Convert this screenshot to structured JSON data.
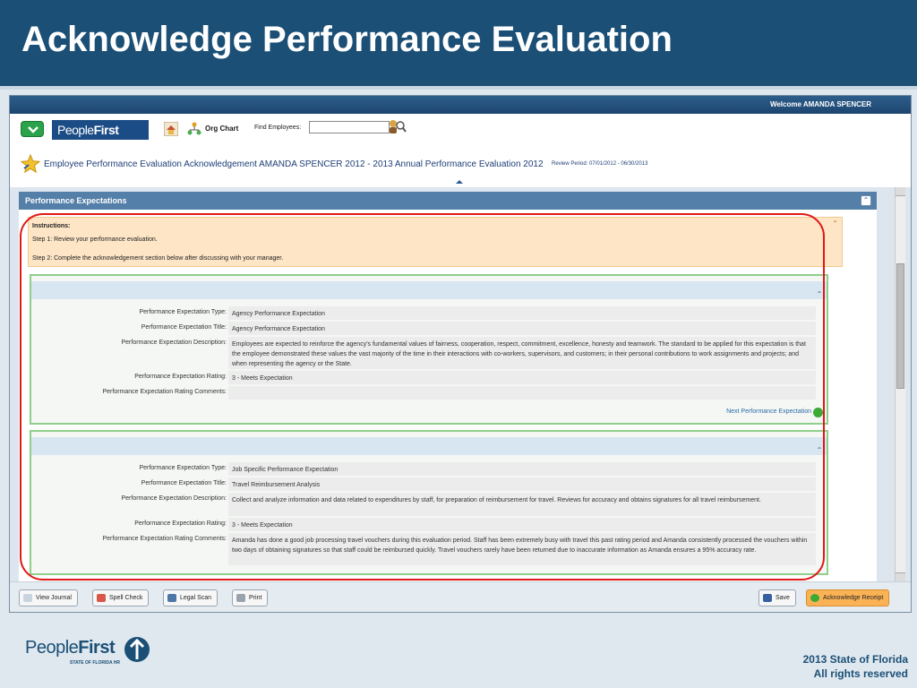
{
  "slide": {
    "title": "Acknowledge Performance Evaluation",
    "footer_copyright_line1": "2013 State of Florida",
    "footer_copyright_line2": "All rights reserved",
    "footer_logo_people": "People",
    "footer_logo_first": "First",
    "footer_logo_sub": "STATE OF FLORIDA HR"
  },
  "app": {
    "welcome": "Welcome AMANDA SPENCER",
    "logo_people": "People",
    "logo_first": "First",
    "org_chart": "Org Chart",
    "find_employees_label": "Find Employees:",
    "find_employees_value": ""
  },
  "page": {
    "title": "Employee Performance Evaluation Acknowledgement    AMANDA SPENCER   2012 - 2013 Annual Performance Evaluation 2012",
    "review_period": "Review Period: 07/01/2012 - 06/30/2013"
  },
  "panel": {
    "title": "Performance Expectations"
  },
  "instructions": {
    "title": "Instructions:",
    "step1": "Step 1:  Review your performance evaluation.",
    "step2": "Step 2:  Complete the acknowledgement section below after discussing with your manager."
  },
  "labels": {
    "type": "Performance Expectation Type:",
    "title": "Performance Expectation Title:",
    "description": "Performance Expectation Description:",
    "rating": "Performance Expectation Rating:",
    "comments": "Performance Expectation Rating Comments:"
  },
  "expectations": [
    {
      "type": "Agency Performance Expectation",
      "title": "Agency Performance Expectation",
      "description": "Employees are expected to reinforce the agency's fundamental values of fairness, cooperation, respect, commitment, excellence, honesty and teamwork. The standard to be applied for this expectation is that the employee demonstrated these values the vast majority of the time in their interactions with co-workers, supervisors, and customers; in their personal contributions to work assignments and projects; and when representing the agency or the State.",
      "rating": "3 - Meets Expectation",
      "comments": "",
      "next_link": "Next Performance Expectation"
    },
    {
      "type": "Job Specific Performance Expectation",
      "title": "Travel Reimbursement Analysis",
      "description": "Collect and analyze information and data related to expenditures by staff, for preparation of reimbursement for travel.  Reviews for accuracy and obtains signatures for all travel reimbursement.",
      "rating": "3 - Meets Expectation",
      "comments": "Amanda has done a good job processing travel vouchers during this evaluation period. Staff has been extremely busy with travel this past rating period and Amanda consistently processed the vouchers within two days of obtaining signatures so that staff could be reimbursed quickly. Travel vouchers rarely have been returned due to inaccurate information as Amanda ensures a 95% accuracy rate."
    }
  ],
  "toolbar": {
    "view_journal": "View Journal",
    "spell_check": "Spell Check",
    "legal_scan": "Legal Scan",
    "print": "Print",
    "save": "Save",
    "acknowledge_receipt": "Acknowledge Receipt"
  },
  "colors": {
    "slide_header": "#1b4f76",
    "panel_header": "#537fa8",
    "instructions_bg": "#fde5c6",
    "card_border": "#8fcf8b",
    "highlight_circle": "#e01818",
    "acknowledge_button": "#fbb255"
  }
}
